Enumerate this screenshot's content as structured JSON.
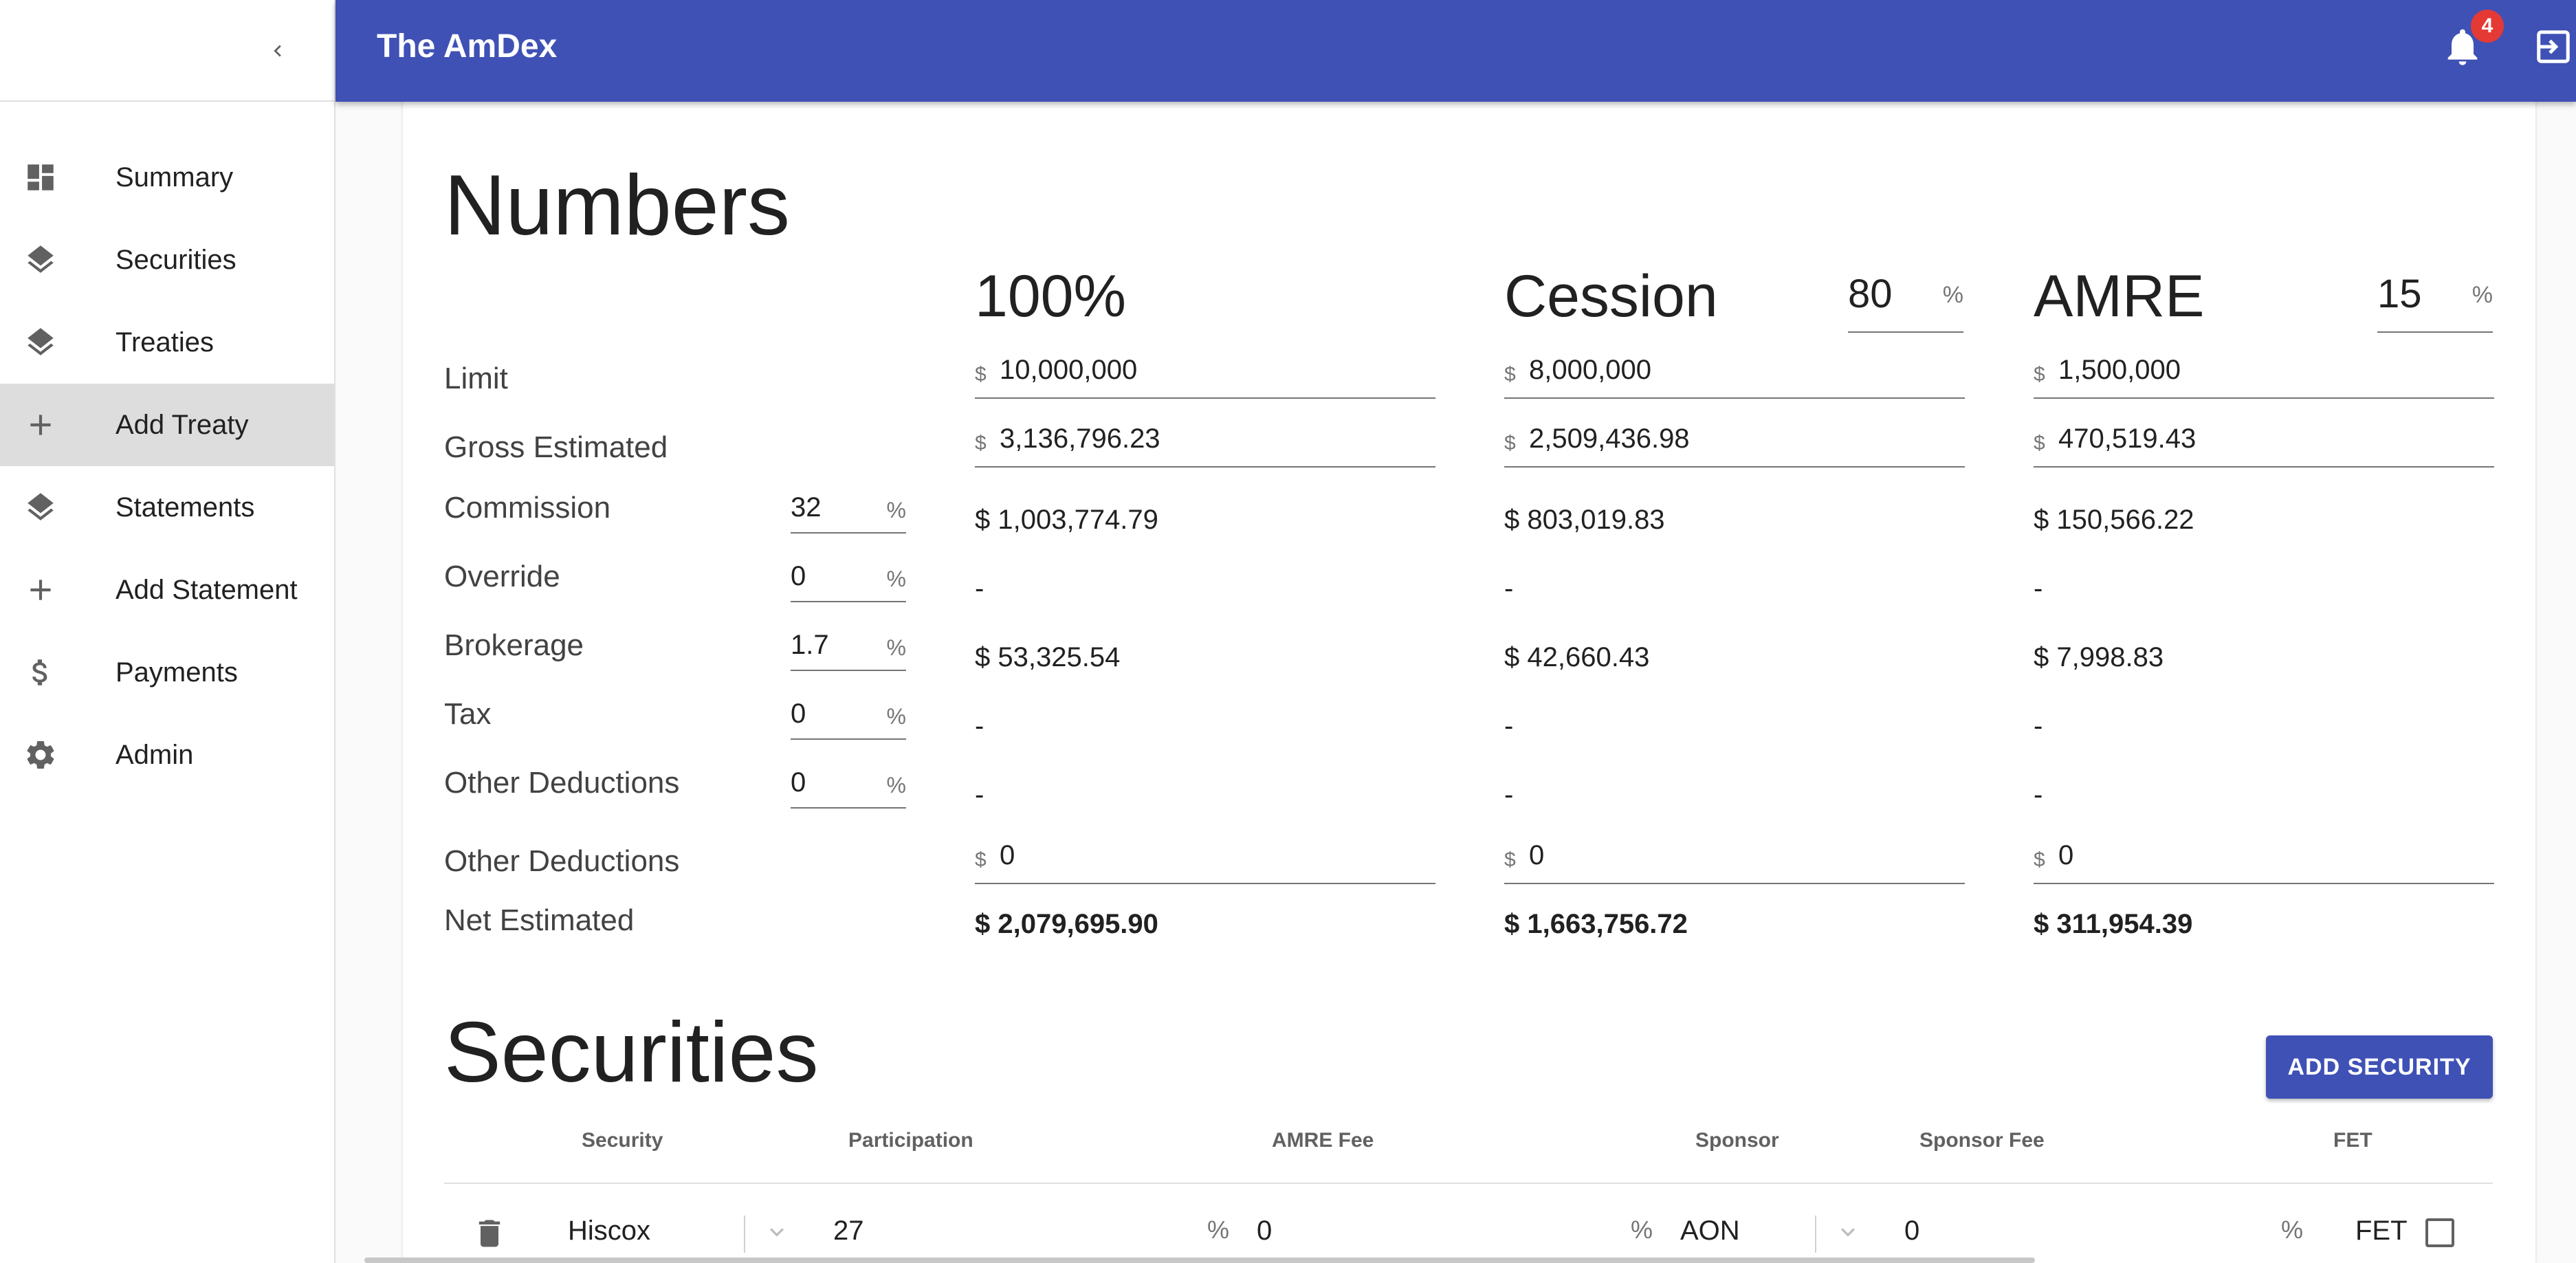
{
  "app": {
    "title": "The AmDex",
    "notification_count": "4"
  },
  "sidebar": {
    "items": [
      {
        "label": "Summary",
        "icon": "dashboard-icon"
      },
      {
        "label": "Securities",
        "icon": "layers-icon"
      },
      {
        "label": "Treaties",
        "icon": "layers-icon"
      },
      {
        "label": "Add Treaty",
        "icon": "plus-icon",
        "active": true
      },
      {
        "label": "Statements",
        "icon": "layers-icon"
      },
      {
        "label": "Add Statement",
        "icon": "plus-icon"
      },
      {
        "label": "Payments",
        "icon": "dollar-icon"
      },
      {
        "label": "Admin",
        "icon": "gear-icon"
      }
    ]
  },
  "numbers": {
    "title": "Numbers",
    "columns": {
      "full": {
        "heading": "100%"
      },
      "cession": {
        "heading": "Cession",
        "percent": "80",
        "suffix": "%"
      },
      "amre": {
        "heading": "AMRE",
        "percent": "15",
        "suffix": "%"
      }
    },
    "rows": {
      "limit": {
        "label": "Limit",
        "full": "10,000,000",
        "cession": "8,000,000",
        "amre": "1,500,000",
        "prefix": "$"
      },
      "gross": {
        "label": "Gross Estimated",
        "full": "3,136,796.23",
        "cession": "2,509,436.98",
        "amre": "470,519.43",
        "prefix": "$"
      },
      "commission": {
        "label": "Commission",
        "pct": "32",
        "suffix": "%",
        "full": "$ 1,003,774.79",
        "cession": "$ 803,019.83",
        "amre": "$ 150,566.22"
      },
      "override": {
        "label": "Override",
        "pct": "0",
        "suffix": "%",
        "full": "-",
        "cession": "-",
        "amre": "-"
      },
      "brokerage": {
        "label": "Brokerage",
        "pct": "1.7",
        "suffix": "%",
        "full": "$ 53,325.54",
        "cession": "$ 42,660.43",
        "amre": "$ 7,998.83"
      },
      "tax": {
        "label": "Tax",
        "pct": "0",
        "suffix": "%",
        "full": "-",
        "cession": "-",
        "amre": "-"
      },
      "other_pct": {
        "label": "Other Deductions",
        "pct": "0",
        "suffix": "%",
        "full": "-",
        "cession": "-",
        "amre": "-"
      },
      "other_amt": {
        "label": "Other Deductions",
        "prefix": "$",
        "full": "0",
        "cession": "0",
        "amre": "0"
      },
      "net": {
        "label": "Net Estimated",
        "full": "$ 2,079,695.90",
        "cession": "$ 1,663,756.72",
        "amre": "$ 311,954.39"
      }
    }
  },
  "securities": {
    "title": "Securities",
    "add_button": "ADD SECURITY",
    "headers": [
      "Security",
      "Participation",
      "AMRE Fee",
      "Sponsor",
      "Sponsor Fee",
      "FET"
    ],
    "row": {
      "security": "Hiscox",
      "participation": "27",
      "participation_suffix": "%",
      "amre_fee": "0",
      "amre_fee_suffix": "%",
      "sponsor": "AON",
      "sponsor_fee": "0",
      "sponsor_fee_suffix": "%",
      "fet_label": "FET",
      "fet_checked": false
    }
  }
}
